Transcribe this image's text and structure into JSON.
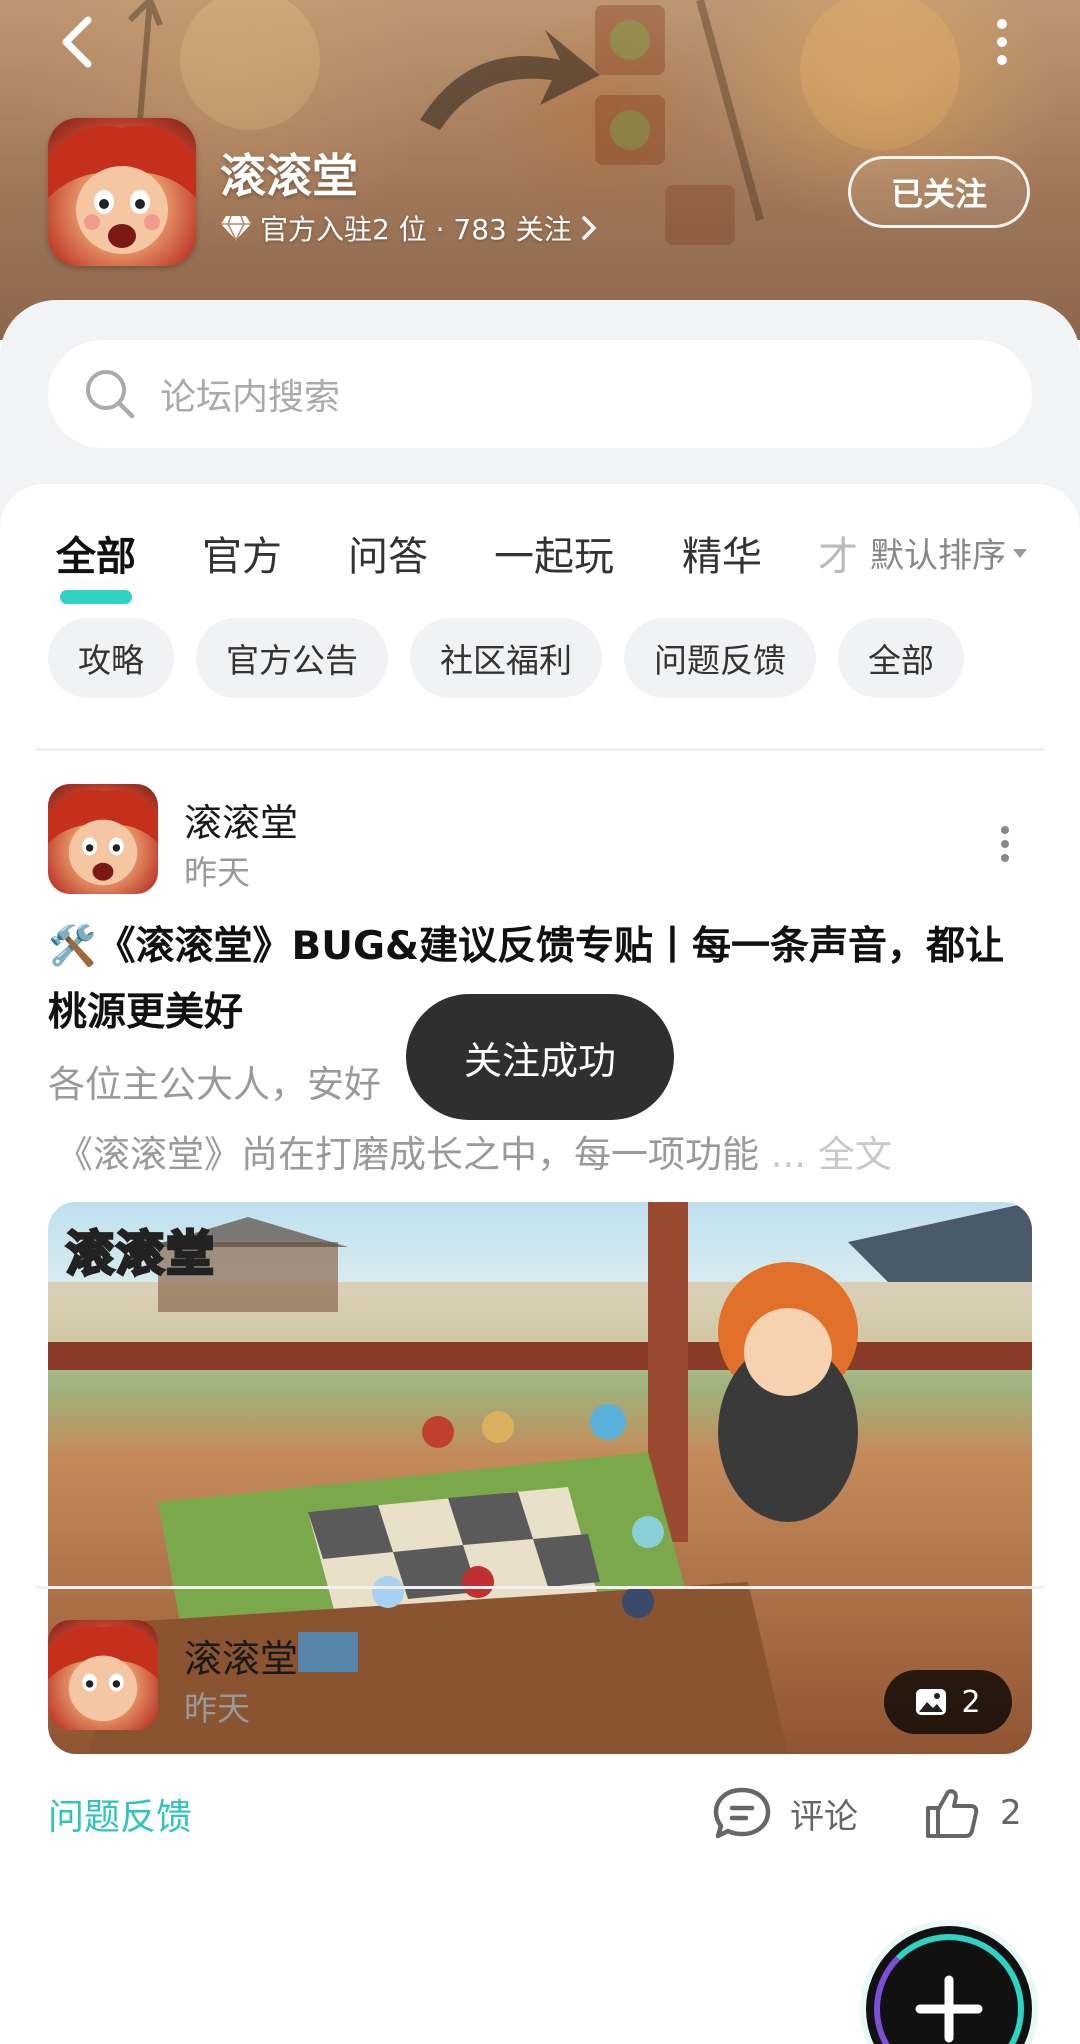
{
  "header": {
    "forum_name": "滚滚堂",
    "meta": "官方入驻2 位 · 783 关注",
    "follow_label": "已关注"
  },
  "search": {
    "placeholder": "论坛内搜索"
  },
  "tabs": [
    {
      "label": "全部"
    },
    {
      "label": "官方"
    },
    {
      "label": "问答"
    },
    {
      "label": "一起玩"
    },
    {
      "label": "精华"
    }
  ],
  "tab_overflow_fragment": "才",
  "sort_label": "默认排序",
  "chips": [
    "攻略",
    "官方公告",
    "社区福利",
    "问题反馈",
    "全部"
  ],
  "post": {
    "author": "滚滚堂",
    "time": "昨天",
    "title": "🛠️《滚滚堂》BUG&建议反馈专贴丨每一条声音，都让桃源更美好",
    "excerpt_line1": "各位主公大人，安好",
    "excerpt_line2": "《滚滚堂》尚在打磨成长之中，每一项功能",
    "ellipsis": " ... ",
    "full_text_label": "全文",
    "image_watermark": "滚滚堂",
    "image_count": "2",
    "tag": "问题反馈",
    "comment_label": "评论",
    "like_count": "2"
  },
  "post2": {
    "author": "滚滚堂",
    "time": "昨天"
  },
  "toast": "关注成功",
  "colors": {
    "accent": "#2fd3c4",
    "tag": "#2fc5b8",
    "toast_bg": "#2f2f2f"
  }
}
